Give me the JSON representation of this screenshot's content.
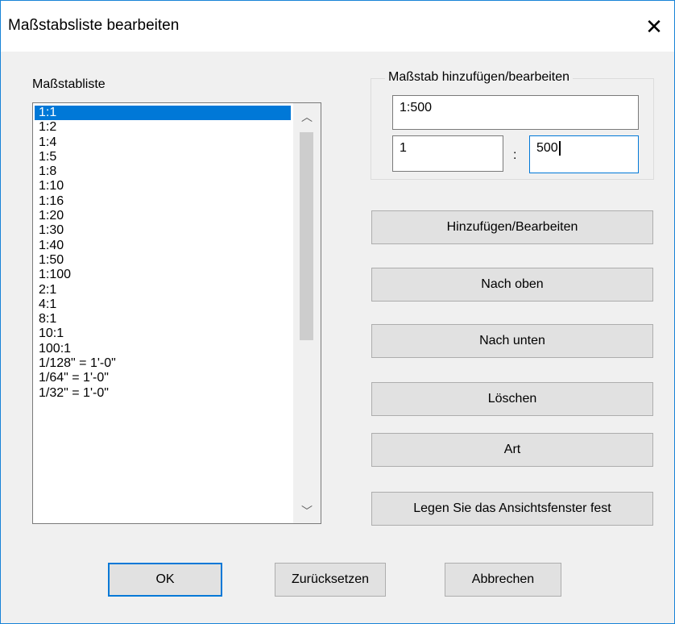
{
  "window": {
    "title": "Maßstabsliste bearbeiten",
    "close_glyph": "✕"
  },
  "scale_list": {
    "label": "Maßstabliste",
    "items": [
      "1:1",
      "1:2",
      "1:4",
      "1:5",
      "1:8",
      "1:10",
      "1:16",
      "1:20",
      "1:30",
      "1:40",
      "1:50",
      "1:100",
      "2:1",
      "4:1",
      "8:1",
      "10:1",
      "100:1",
      "1/128\" = 1'-0\"",
      "1/64\" = 1'-0\"",
      "1/32\" = 1'-0\""
    ],
    "selected_index": 0
  },
  "scrollbar": {
    "up_glyph": "︿",
    "down_glyph": "﹀"
  },
  "edit_group": {
    "label": "Maßstab hinzufügen/bearbeiten",
    "scale_value": "1:500",
    "left_value": "1",
    "separator": ":",
    "right_value": "500"
  },
  "actions": {
    "add_edit": "Hinzufügen/Bearbeiten",
    "move_up": "Nach oben",
    "move_down": "Nach unten",
    "delete": "Löschen",
    "type": "Art",
    "set_viewport": "Legen Sie das Ansichtsfenster fest"
  },
  "footer": {
    "ok": "OK",
    "reset": "Zurücksetzen",
    "cancel": "Abbrechen"
  },
  "colors": {
    "accent": "#0078d7",
    "selection_text": "#ffffff",
    "window_border": "#1883d7"
  }
}
